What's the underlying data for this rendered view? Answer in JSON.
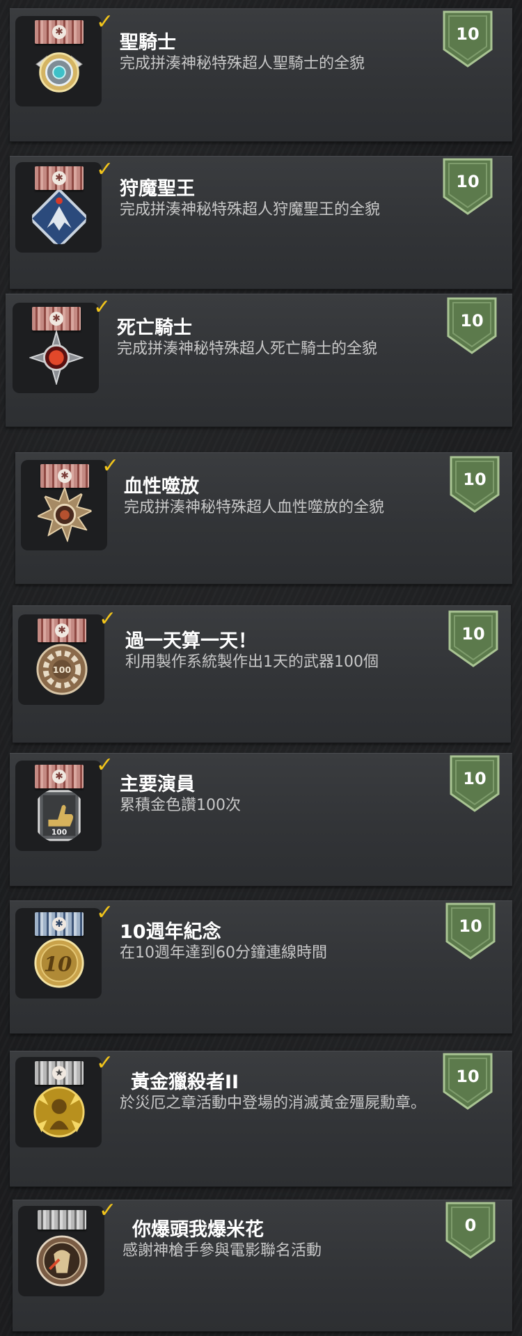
{
  "achievements": [
    {
      "title": "聖騎士",
      "description": "完成拼湊神秘特殊超人聖騎士的全貌",
      "points": "10",
      "medal_icon": "paladin-medal-icon",
      "ribbon": "red"
    },
    {
      "title": "狩魔聖王",
      "description": "完成拼湊神秘特殊超人狩魔聖王的全貌",
      "points": "10",
      "medal_icon": "demon-hunter-king-medal-icon",
      "ribbon": "red"
    },
    {
      "title": "死亡騎士",
      "description": "完成拼湊神秘特殊超人死亡騎士的全貌",
      "points": "10",
      "medal_icon": "death-knight-medal-icon",
      "ribbon": "red"
    },
    {
      "title": "血性噬放",
      "description": "完成拼湊神秘特殊超人血性噬放的全貌",
      "points": "10",
      "medal_icon": "bloodlust-medal-icon",
      "ribbon": "red"
    },
    {
      "title": "過一天算一天！",
      "description": "利用製作系統製作出1天的武器100個",
      "points": "10",
      "medal_icon": "gear-100-medal-icon",
      "ribbon": "red"
    },
    {
      "title": "主要演員",
      "description": "累積金色讚100次",
      "points": "10",
      "medal_icon": "thumbs-up-100-medal-icon",
      "ribbon": "red"
    },
    {
      "title": "10週年紀念",
      "description": "在10週年達到60分鐘連線時間",
      "points": "10",
      "medal_icon": "10th-anniversary-medal-icon",
      "ribbon": "blue"
    },
    {
      "title": "黃金獵殺者II",
      "description": "於災厄之章活動中登場的消滅黃金殭屍勳章。",
      "points": "10",
      "medal_icon": "golden-hunter-medal-icon",
      "ribbon": "blue"
    },
    {
      "title": "你爆頭我爆米花",
      "description": "感謝神槍手參與電影聯名活動",
      "points": "0",
      "medal_icon": "popcorn-medal-icon",
      "ribbon": "grey"
    }
  ],
  "colors": {
    "checkmark": "#f2c51b",
    "shield_green": "#5c7a4c",
    "card_bg": "#35373a"
  }
}
